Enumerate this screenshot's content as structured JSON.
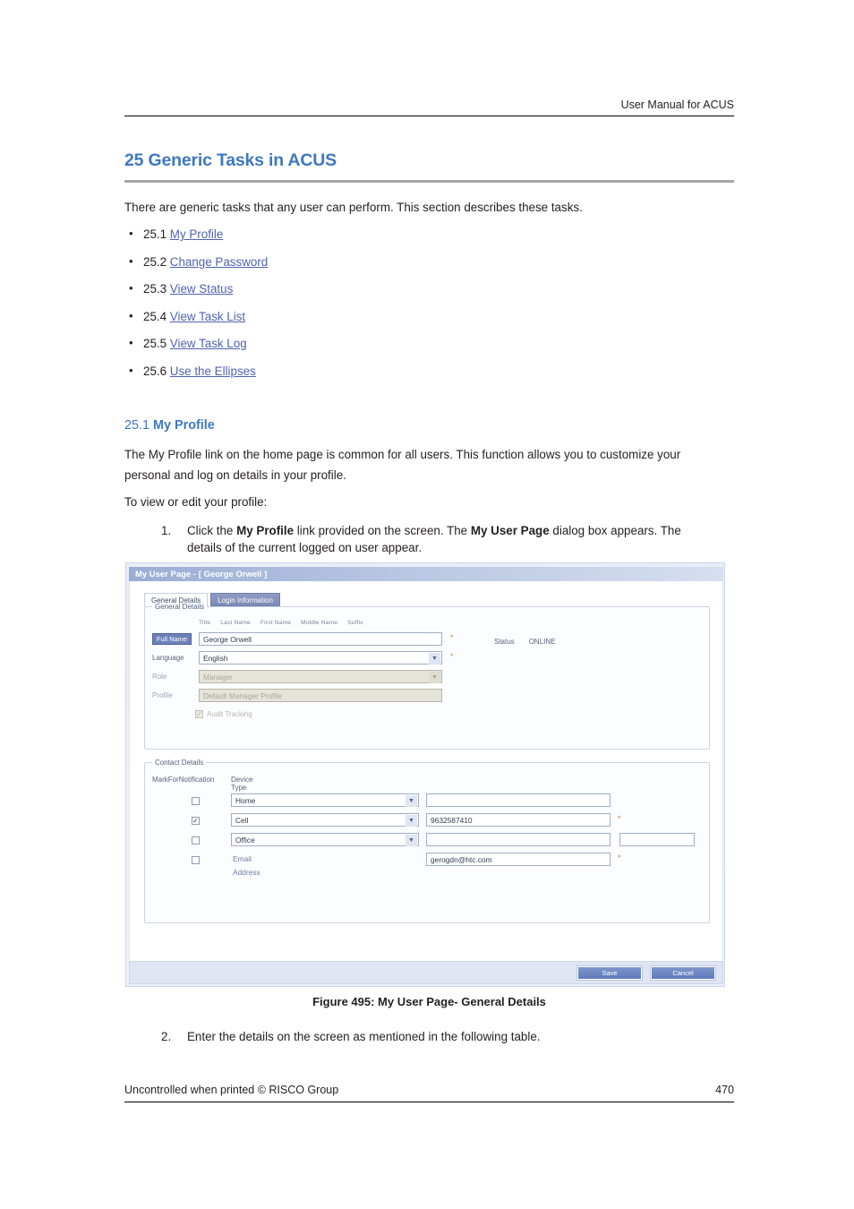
{
  "header": {
    "running_title": "User Manual for ACUS"
  },
  "chapter": {
    "title": "25 Generic Tasks in ACUS"
  },
  "intro": {
    "text": "There are generic tasks that any user can perform. This section describes these tasks."
  },
  "toc": {
    "items": [
      {
        "number": "25.1",
        "label": "My Profile"
      },
      {
        "number": "25.2",
        "label": "Change Password"
      },
      {
        "number": "25.3",
        "label": "View Status"
      },
      {
        "number": "25.4",
        "label": "View Task List"
      },
      {
        "number": "25.5",
        "label": "View Task Log"
      },
      {
        "number": "25.6",
        "label": "Use the Ellipses"
      }
    ]
  },
  "section": {
    "number": "25.1",
    "title": "My Profile",
    "para1": "The My Profile link on the home page is common for all users. This function allows you to customize your personal and log on details in your profile.",
    "para2": "To view or edit your profile:",
    "steps": [
      {
        "num": "1.",
        "text": "Click the My Profile link provided on the screen. The My User Page dialog box appears. The details of the current logged on user appear."
      },
      {
        "num": "2.",
        "text": "Enter the details on the screen as mentioned in the following table."
      }
    ]
  },
  "figure": {
    "caption": "Figure 495: My User Page- General Details",
    "window": {
      "title": "My User Page - [ George Orwell ]",
      "tabs": [
        {
          "label": "General Details",
          "active": true
        },
        {
          "label": "Login Information",
          "active": false
        }
      ],
      "general_panel": {
        "legend": "General Details",
        "name_columns": [
          "Title",
          "Last Name",
          "First Name",
          "Middle Name",
          "Suffix"
        ],
        "fields": [
          {
            "label": "Full Name",
            "value": "George Orwell",
            "required": "*"
          },
          {
            "label": "Language",
            "value": "English",
            "required": "*"
          },
          {
            "label": "Role",
            "value": "Manager",
            "required": ""
          },
          {
            "label": "Profile",
            "value": "Default Manager Profile",
            "required": ""
          }
        ],
        "audit_label": "Audit Tracking",
        "status_label": "Status",
        "status_value": "ONLINE"
      },
      "contact_panel": {
        "legend": "Contact Details",
        "col_notify": "MarkForNotification",
        "col_device": "Device Type",
        "rows": [
          {
            "checked": false,
            "device": "Home",
            "value": "",
            "required": "",
            "has_extra": false,
            "is_select": true
          },
          {
            "checked": true,
            "device": "Cell",
            "value": "9632587410",
            "required": "*",
            "has_extra": false,
            "is_select": true
          },
          {
            "checked": false,
            "device": "Office",
            "value": "",
            "required": "",
            "has_extra": true,
            "is_select": true
          },
          {
            "checked": false,
            "device": "Email Address",
            "value": "gerogdn@htc.com",
            "required": "*",
            "has_extra": false,
            "is_select": false
          }
        ]
      },
      "buttons": {
        "save": "Save",
        "cancel": "Cancel"
      }
    }
  },
  "footer": {
    "left": "Uncontrolled when printed © RISCO Group",
    "page": "470"
  }
}
